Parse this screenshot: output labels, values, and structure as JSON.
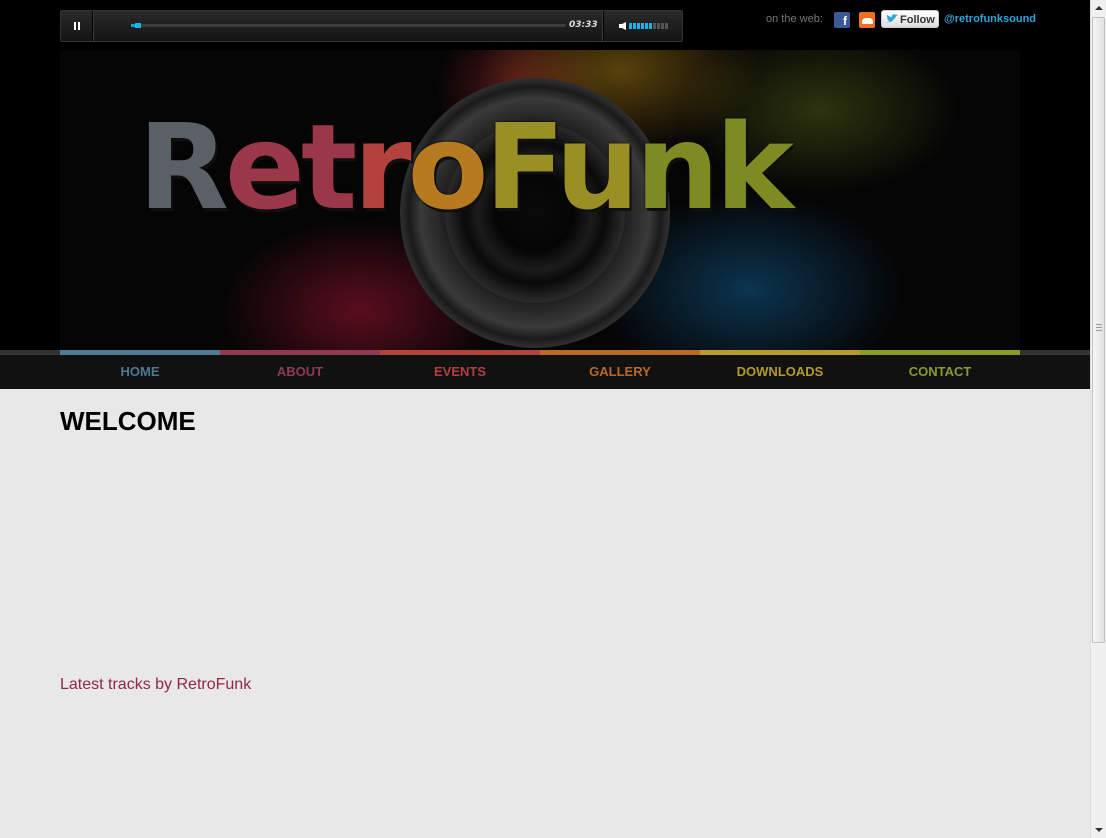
{
  "player": {
    "time": "03:33",
    "progress_fraction": 0.01,
    "volume_level_fraction": 0.6
  },
  "social": {
    "label": "on the web:",
    "facebook_icon": "facebook-icon",
    "soundcloud_icon": "soundcloud-icon",
    "follow_label": "Follow",
    "twitter_handle": "@retrofunksound"
  },
  "banner": {
    "logo_parts": [
      "R",
      "et",
      "r",
      "o",
      "Fu",
      "nk"
    ]
  },
  "nav": {
    "items": [
      {
        "label": "HOME",
        "color": "#4b7a94",
        "bar": "#4e7c95"
      },
      {
        "label": "ABOUT",
        "color": "#8f3c52",
        "bar": "#8f3a50"
      },
      {
        "label": "EVENTS",
        "color": "#b2403a",
        "bar": "#b5423c"
      },
      {
        "label": "GALLERY",
        "color": "#b8692a",
        "bar": "#b86a28"
      },
      {
        "label": "DOWNLOADS",
        "color": "#b59a2a",
        "bar": "#b89b2c"
      },
      {
        "label": "CONTACT",
        "color": "#8a9a2e",
        "bar": "#8a9b2c"
      }
    ]
  },
  "content": {
    "heading": "WELCOME",
    "latest_link": "Latest tracks by RetroFunk"
  }
}
